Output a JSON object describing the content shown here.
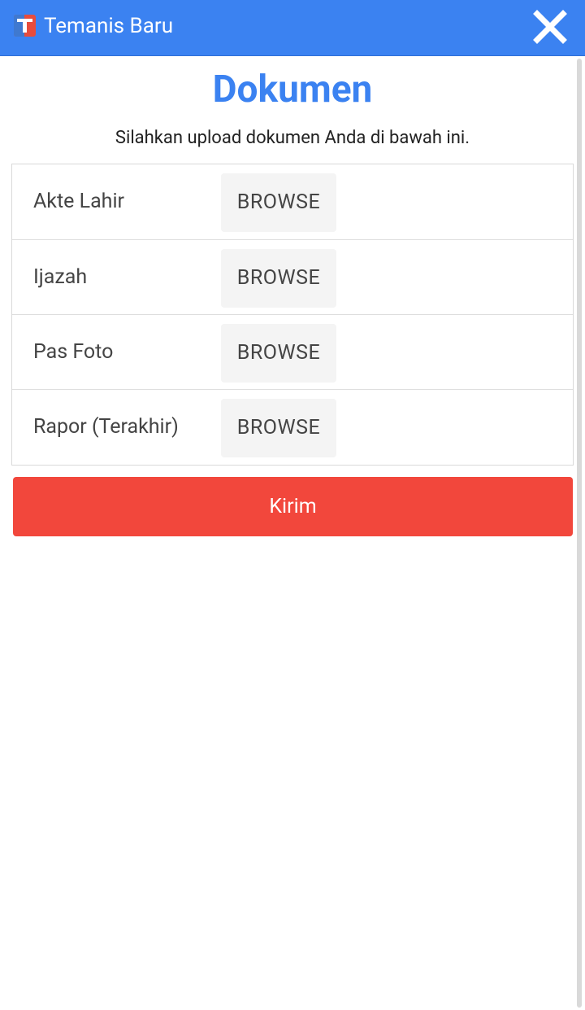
{
  "app": {
    "title": "Temanis Baru",
    "icon": "app-logo-t-icon",
    "close_icon": "close-icon",
    "accent_color": "#3b82f1"
  },
  "page": {
    "title": "Dokumen",
    "subtitle": "Silahkan upload dokumen Anda di bawah ini."
  },
  "documents": [
    {
      "label": "Akte Lahir",
      "button": "BROWSE"
    },
    {
      "label": "Ijazah",
      "button": "BROWSE"
    },
    {
      "label": "Pas Foto",
      "button": "BROWSE"
    },
    {
      "label": "Rapor (Terakhir)",
      "button": "BROWSE"
    }
  ],
  "submit": {
    "label": "Kirim",
    "color": "#f2473c"
  }
}
